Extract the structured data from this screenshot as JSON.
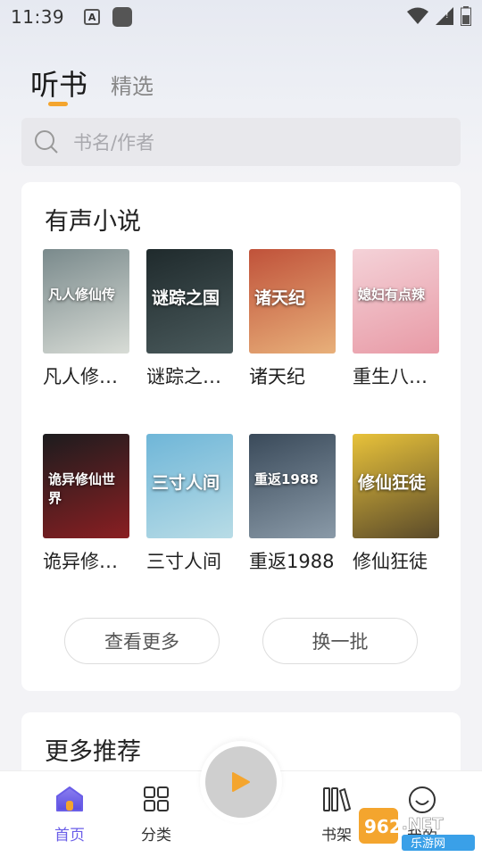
{
  "status_bar": {
    "time": "11:39"
  },
  "tabs": [
    {
      "label": "听书",
      "active": true
    },
    {
      "label": "精选",
      "active": false
    }
  ],
  "search": {
    "placeholder": "书名/作者"
  },
  "audio_novels": {
    "title": "有声小说",
    "books": [
      {
        "title": "凡人修…",
        "cover_text": "凡人修仙传",
        "cover_colors": [
          "#7a8a8c",
          "#d8dcd6"
        ]
      },
      {
        "title": "谜踪之…",
        "cover_text": "谜踪之国",
        "cover_colors": [
          "#1f2a2c",
          "#4a5a5c"
        ]
      },
      {
        "title": "诸天纪",
        "cover_text": "诸天纪",
        "cover_colors": [
          "#c0523a",
          "#e8b07a"
        ]
      },
      {
        "title": "重生八…",
        "cover_text": "媳妇有点辣",
        "cover_colors": [
          "#f4d2d8",
          "#e89aa6"
        ]
      },
      {
        "title": "诡异修…",
        "cover_text": "诡异修仙世界",
        "cover_colors": [
          "#1c1c1e",
          "#8a1f22"
        ]
      },
      {
        "title": "三寸人间",
        "cover_text": "三寸人间",
        "cover_colors": [
          "#6fb6d8",
          "#b8dce6"
        ]
      },
      {
        "title": "重返1988",
        "cover_text": "重返1988",
        "cover_colors": [
          "#3a4a5a",
          "#8a9aa8"
        ]
      },
      {
        "title": "修仙狂徒",
        "cover_text": "修仙狂徒",
        "cover_colors": [
          "#e8c23a",
          "#5a4a2a"
        ]
      }
    ],
    "more_button": "查看更多",
    "refresh_button": "换一批"
  },
  "more_recommend": {
    "title": "更多推荐"
  },
  "bottom_nav": [
    {
      "label": "首页",
      "icon": "home-icon",
      "active": true
    },
    {
      "label": "分类",
      "icon": "category-icon",
      "active": false
    },
    {
      "label": "书架",
      "icon": "bookshelf-icon",
      "active": false
    },
    {
      "label": "我的",
      "icon": "profile-icon",
      "active": false
    }
  ],
  "colors": {
    "accent": "#f4a52e",
    "nav_active": "#6a5ee8",
    "play_bg": "#cfcfcf",
    "play_icon": "#f4a52e"
  }
}
